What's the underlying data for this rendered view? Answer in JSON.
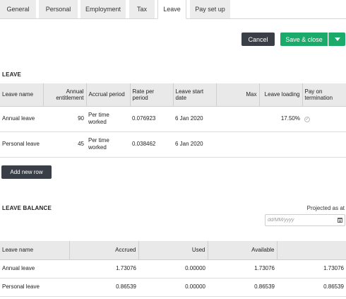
{
  "tabs": [
    {
      "label": "General"
    },
    {
      "label": "Personal"
    },
    {
      "label": "Employment"
    },
    {
      "label": "Tax"
    },
    {
      "label": "Leave"
    },
    {
      "label": "Pay set up"
    }
  ],
  "actions": {
    "cancel_label": "Cancel",
    "save_label": "Save & close"
  },
  "leave": {
    "title": "LEAVE",
    "columns": [
      "Leave name",
      "Annual entitlement",
      "Accrual period",
      "Rate per period",
      "Leave start date",
      "Max",
      "Leave loading",
      "Pay on termination"
    ],
    "rows": [
      {
        "name": "Annual leave",
        "entitlement": "90",
        "accrual": "Per time worked",
        "rate": "0.076923",
        "start": "6 Jan 2020",
        "max": "",
        "loading": "17.50%",
        "pay_on_termination": true
      },
      {
        "name": "Personal leave",
        "entitlement": "45",
        "accrual": "Per time worked",
        "rate": "0.038462",
        "start": "6 Jan 2020",
        "max": "",
        "loading": "",
        "pay_on_termination": false
      }
    ],
    "add_row_label": "Add new row"
  },
  "balance": {
    "title": "LEAVE BALANCE",
    "projected_label": "Projected as at",
    "date_placeholder": "dd/MM/yyyy",
    "columns": [
      "Leave name",
      "Accrued",
      "Used",
      "Available",
      ""
    ],
    "rows": [
      {
        "name": "Annual leave",
        "accrued": "1.73076",
        "used": "0.00000",
        "available": "1.73076",
        "projected": "1.73076"
      },
      {
        "name": "Personal leave",
        "accrued": "0.86539",
        "used": "0.00000",
        "available": "0.86539",
        "projected": "0.86539"
      }
    ]
  },
  "colors": {
    "primary_dark": "#3a3f47",
    "save_green": "#1aaa6a",
    "header_grey": "#e9e9e9"
  }
}
